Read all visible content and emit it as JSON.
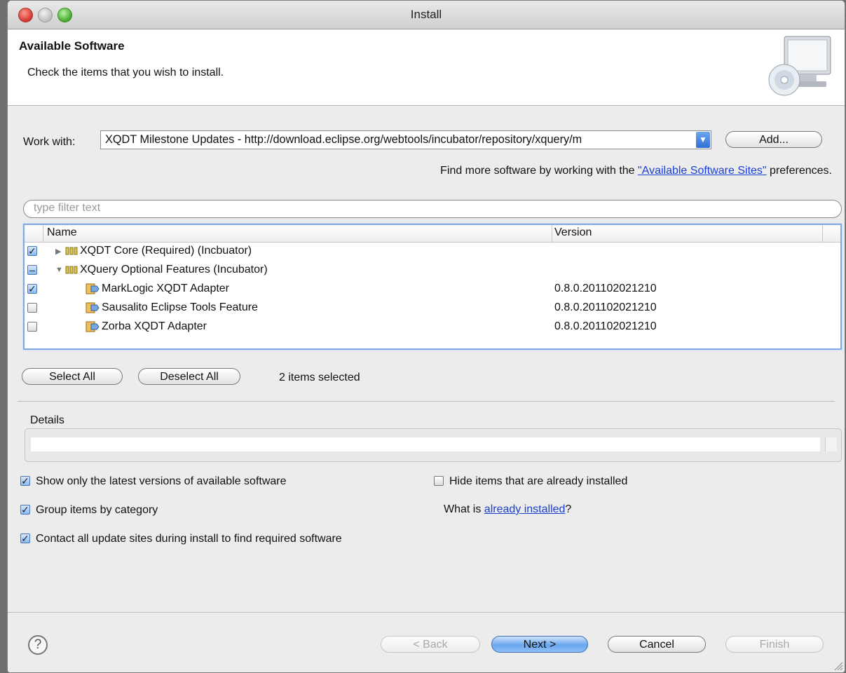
{
  "window": {
    "title": "Install"
  },
  "header": {
    "title": "Available Software",
    "description": "Check the items that you wish to install."
  },
  "work_with": {
    "label": "Work with:",
    "value": "XQDT Milestone Updates - http://download.eclipse.org/webtools/incubator/repository/xquery/m",
    "add_button": "Add...",
    "hint_prefix": "Find more software by working with the ",
    "hint_link": "\"Available Software Sites\"",
    "hint_suffix": " preferences."
  },
  "filter": {
    "placeholder": "type filter text"
  },
  "tree": {
    "columns": [
      "Name",
      "Version"
    ],
    "rows": [
      {
        "name": "XQDT Core (Required) (Incbuator)",
        "version": "",
        "state": "checked",
        "expander": "collapsed"
      },
      {
        "name": "XQuery Optional Features (Incubator)",
        "version": "",
        "state": "mixed",
        "expander": "expanded"
      },
      {
        "name": "MarkLogic XQDT Adapter",
        "version": "0.8.0.201102021210",
        "state": "checked"
      },
      {
        "name": "Sausalito Eclipse Tools Feature",
        "version": "0.8.0.201102021210",
        "state": "unchecked"
      },
      {
        "name": "Zorba XQDT Adapter",
        "version": "0.8.0.201102021210",
        "state": "unchecked"
      }
    ]
  },
  "selection": {
    "select_all": "Select All",
    "deselect_all": "Deselect All",
    "status": "2 items selected"
  },
  "details": {
    "label": "Details"
  },
  "options": {
    "latest_only": {
      "label": "Show only the latest versions of available software",
      "checked": true
    },
    "group_by_category": {
      "label": "Group items by category",
      "checked": true
    },
    "contact_all_sites": {
      "label": "Contact all update sites during install to find required software",
      "checked": true
    },
    "hide_installed": {
      "label": "Hide items that are already installed",
      "checked": false
    },
    "what_is_prefix": "What is ",
    "what_is_link": "already installed",
    "what_is_suffix": "?"
  },
  "footer": {
    "back": "< Back",
    "next": "Next >",
    "cancel": "Cancel",
    "finish": "Finish",
    "help_glyph": "?"
  }
}
